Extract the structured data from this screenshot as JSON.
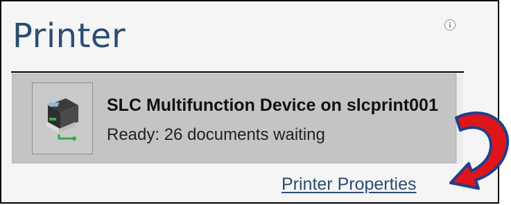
{
  "section": {
    "title": "Printer"
  },
  "printer": {
    "name": "SLC Multifunction Device on slcprint001",
    "status": "Ready: 26 documents waiting",
    "icon": "printer-icon"
  },
  "links": {
    "printer_properties": "Printer Properties"
  },
  "icons": {
    "info": "info-icon",
    "arrow": "curved-arrow-icon"
  },
  "colors": {
    "title": "#2b4d72",
    "link": "#2b4d72",
    "card_background": "#c4c4c4",
    "arrow_fill": "#e0141b",
    "arrow_outline": "#1f3f8f"
  }
}
